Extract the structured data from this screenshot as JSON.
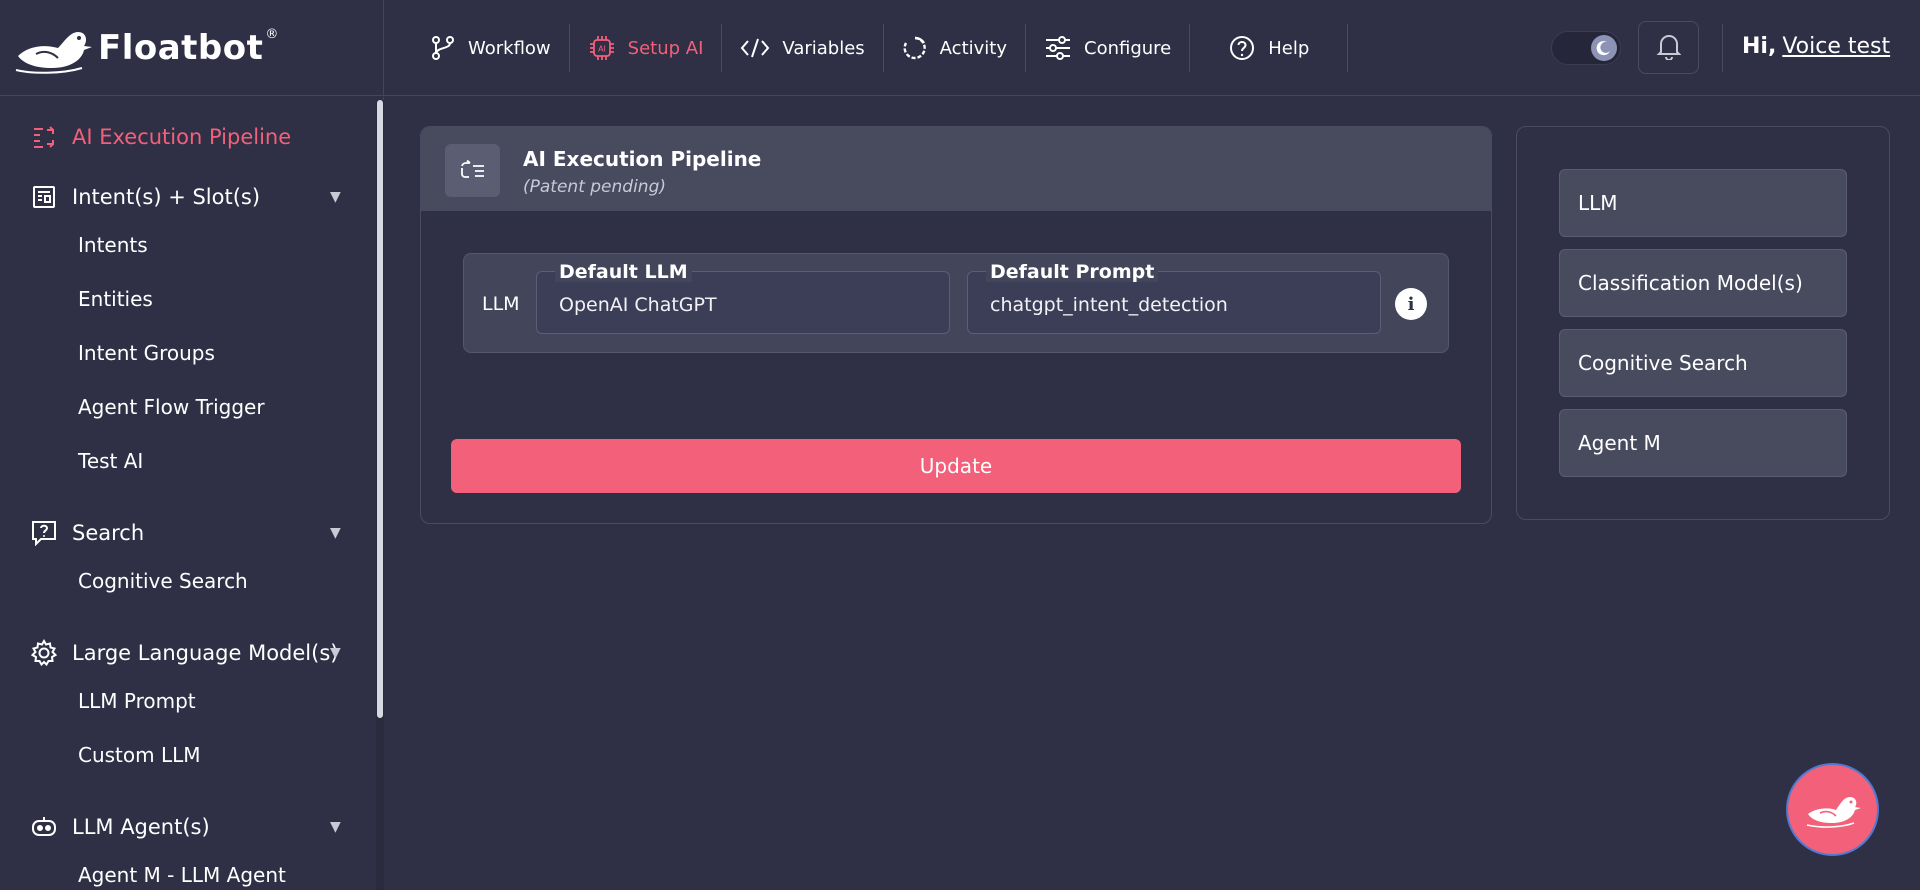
{
  "brand": {
    "name": "Floatbot",
    "reg": "®"
  },
  "nav": [
    {
      "label": "Workflow",
      "icon": "workflow-icon",
      "active": false
    },
    {
      "label": "Setup AI",
      "icon": "ai-chip-icon",
      "active": true
    },
    {
      "label": "Variables",
      "icon": "code-icon",
      "active": false
    },
    {
      "label": "Activity",
      "icon": "activity-icon",
      "active": false
    },
    {
      "label": "Configure",
      "icon": "sliders-icon",
      "active": false
    },
    {
      "label": "Help",
      "icon": "help-icon",
      "active": false
    }
  ],
  "header": {
    "greeting": "Hi,",
    "user": "Voice test"
  },
  "sidebar": {
    "groups": [
      {
        "label": "AI Execution Pipeline",
        "icon": "pipeline-icon",
        "active": true,
        "items": []
      },
      {
        "label": "Intent(s) + Slot(s)",
        "icon": "intent-icon",
        "items": [
          "Intents",
          "Entities",
          "Intent Groups",
          "Agent Flow Trigger",
          "Test AI"
        ]
      },
      {
        "label": "Search",
        "icon": "search-question-icon",
        "items": [
          "Cognitive Search"
        ]
      },
      {
        "label": "Large Language Model(s)",
        "icon": "gear-icon",
        "items": [
          "LLM Prompt",
          "Custom LLM"
        ]
      },
      {
        "label": "LLM Agent(s)",
        "icon": "robot-icon",
        "items": [
          "Agent M - LLM Agent"
        ]
      }
    ]
  },
  "main": {
    "title": "AI Execution Pipeline",
    "subtitle": "(Patent pending)",
    "row_label": "LLM",
    "default_llm": {
      "label": "Default LLM",
      "value": "OpenAI ChatGPT"
    },
    "default_prompt": {
      "label": "Default Prompt",
      "value": "chatgpt_intent_detection"
    },
    "update_label": "Update"
  },
  "right_panel": [
    "LLM",
    "Classification Model(s)",
    "Cognitive Search",
    "Agent M"
  ],
  "colors": {
    "accent": "#f2607a",
    "background": "#2f3045",
    "card_header": "#484a5e"
  }
}
